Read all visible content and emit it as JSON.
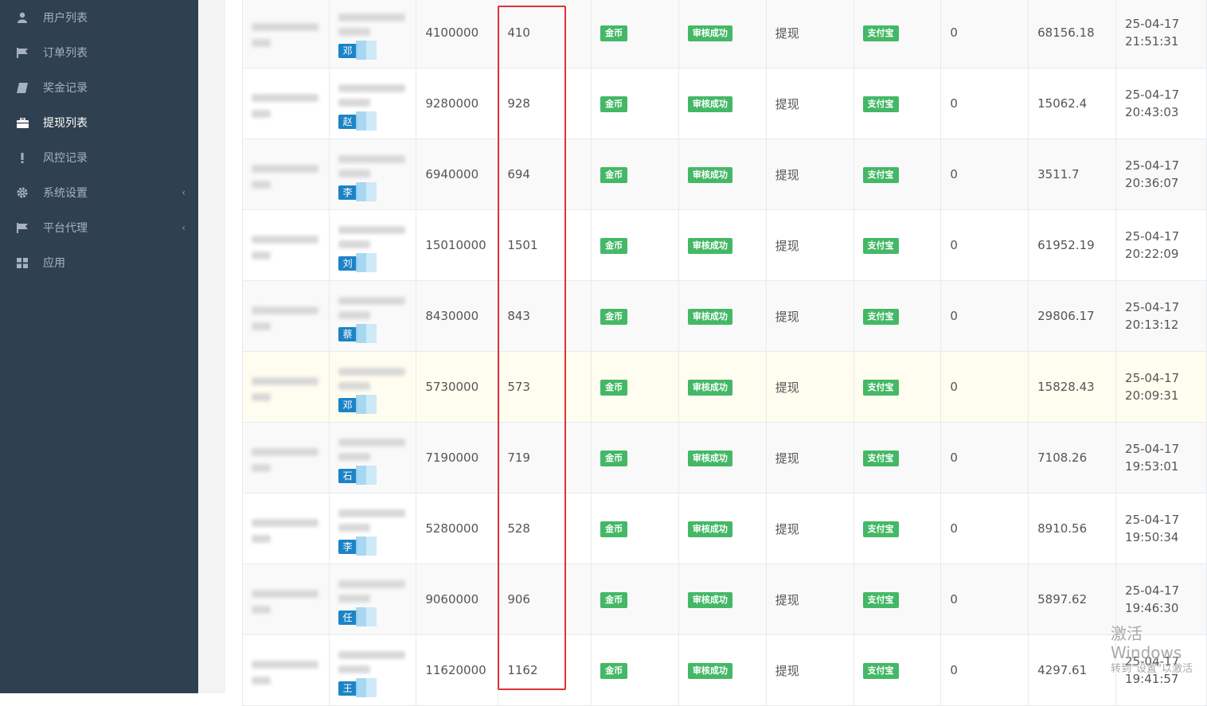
{
  "sidebar": {
    "items": [
      {
        "label": "用户列表",
        "icon": "user-icon"
      },
      {
        "label": "订单列表",
        "icon": "flag-icon"
      },
      {
        "label": "奖金记录",
        "icon": "book-icon"
      },
      {
        "label": "提现列表",
        "icon": "briefcase-icon",
        "active": true
      },
      {
        "label": "风控记录",
        "icon": "exclamation-icon"
      },
      {
        "label": "系统设置",
        "icon": "gear-icon",
        "arrow": "‹"
      },
      {
        "label": "平台代理",
        "icon": "flag-icon",
        "arrow": "‹"
      },
      {
        "label": "应用",
        "icon": "grid-icon"
      }
    ]
  },
  "table": {
    "rows": [
      {
        "name": "邓",
        "amount": "4100000",
        "value": "410",
        "coin": "金币",
        "status": "审核成功",
        "type": "提现",
        "channel": "支付宝",
        "fee": "0",
        "balance": "68156.18",
        "time": "25-04-17 21:51:31"
      },
      {
        "name": "赵",
        "amount": "9280000",
        "value": "928",
        "coin": "金币",
        "status": "审核成功",
        "type": "提现",
        "channel": "支付宝",
        "fee": "0",
        "balance": "15062.4",
        "time": "25-04-17 20:43:03"
      },
      {
        "name": "李",
        "amount": "6940000",
        "value": "694",
        "coin": "金币",
        "status": "审核成功",
        "type": "提现",
        "channel": "支付宝",
        "fee": "0",
        "balance": "3511.7",
        "time": "25-04-17 20:36:07"
      },
      {
        "name": "刘",
        "amount": "15010000",
        "value": "1501",
        "coin": "金币",
        "status": "审核成功",
        "type": "提现",
        "channel": "支付宝",
        "fee": "0",
        "balance": "61952.19",
        "time": "25-04-17 20:22:09"
      },
      {
        "name": "蔡",
        "amount": "8430000",
        "value": "843",
        "coin": "金币",
        "status": "审核成功",
        "type": "提现",
        "channel": "支付宝",
        "fee": "0",
        "balance": "29806.17",
        "time": "25-04-17 20:13:12"
      },
      {
        "name": "邓",
        "amount": "5730000",
        "value": "573",
        "coin": "金币",
        "status": "审核成功",
        "type": "提现",
        "channel": "支付宝",
        "fee": "0",
        "balance": "15828.43",
        "time": "25-04-17 20:09:31"
      },
      {
        "name": "石",
        "amount": "7190000",
        "value": "719",
        "coin": "金币",
        "status": "审核成功",
        "type": "提现",
        "channel": "支付宝",
        "fee": "0",
        "balance": "7108.26",
        "time": "25-04-17 19:53:01"
      },
      {
        "name": "李",
        "amount": "5280000",
        "value": "528",
        "coin": "金币",
        "status": "审核成功",
        "type": "提现",
        "channel": "支付宝",
        "fee": "0",
        "balance": "8910.56",
        "time": "25-04-17 19:50:34"
      },
      {
        "name": "任",
        "amount": "9060000",
        "value": "906",
        "coin": "金币",
        "status": "审核成功",
        "type": "提现",
        "channel": "支付宝",
        "fee": "0",
        "balance": "5897.62",
        "time": "25-04-17 19:46:30"
      },
      {
        "name": "王",
        "amount": "11620000",
        "value": "1162",
        "coin": "金币",
        "status": "审核成功",
        "type": "提现",
        "channel": "支付宝",
        "fee": "0",
        "balance": "4297.61",
        "time": "25-04-17 19:41:57"
      }
    ]
  },
  "watermark": {
    "line1": "激活 Windows",
    "line2": "转到\"设置\"以激活"
  }
}
